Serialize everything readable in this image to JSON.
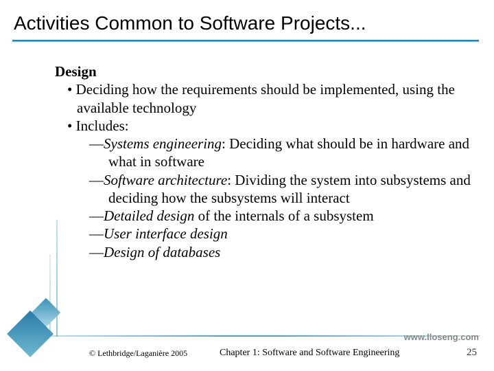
{
  "title": "Activities Common to Software Projects...",
  "heading": "Design",
  "bullet1": "Deciding how the requirements should be implemented, using the available technology",
  "bullet2": "Includes:",
  "dash1a": "Systems engineering",
  "dash1b": ": Deciding what should be in hardware and what in software",
  "dash2a": "Software architecture",
  "dash2b": ": Dividing the system into subsystems and deciding how the subsystems will interact",
  "dash3a": "Detailed design",
  "dash3b": " of the internals of a subsystem",
  "dash4": "User interface design",
  "dash5": "Design of databases",
  "url": "www.lloseng.com",
  "copyright": "© Lethbridge/Laganière 2005",
  "chapter": "Chapter 1: Software and Software Engineering",
  "pagenum": "25"
}
